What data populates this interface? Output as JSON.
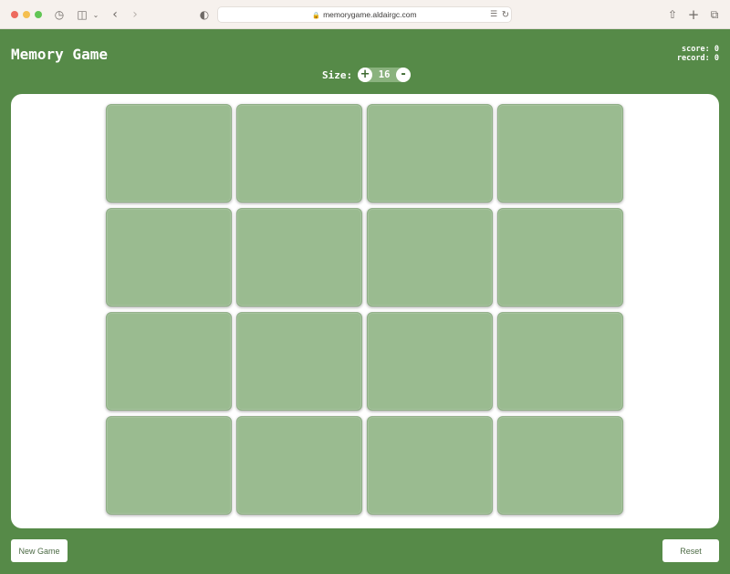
{
  "browser": {
    "url": "memorygame.aldairgc.com"
  },
  "app": {
    "title": "Memory Game",
    "score_label": "score:",
    "score_value": "0",
    "record_label": "record:",
    "record_value": "0",
    "size_label": "Size:",
    "size_value": "16",
    "size_increase": "+",
    "size_decrease": "-",
    "new_game_label": "New Game",
    "reset_label": "Reset",
    "card_count": 16
  },
  "colors": {
    "background": "#568a48",
    "card_back": "#9abb90",
    "board": "#ffffff"
  }
}
